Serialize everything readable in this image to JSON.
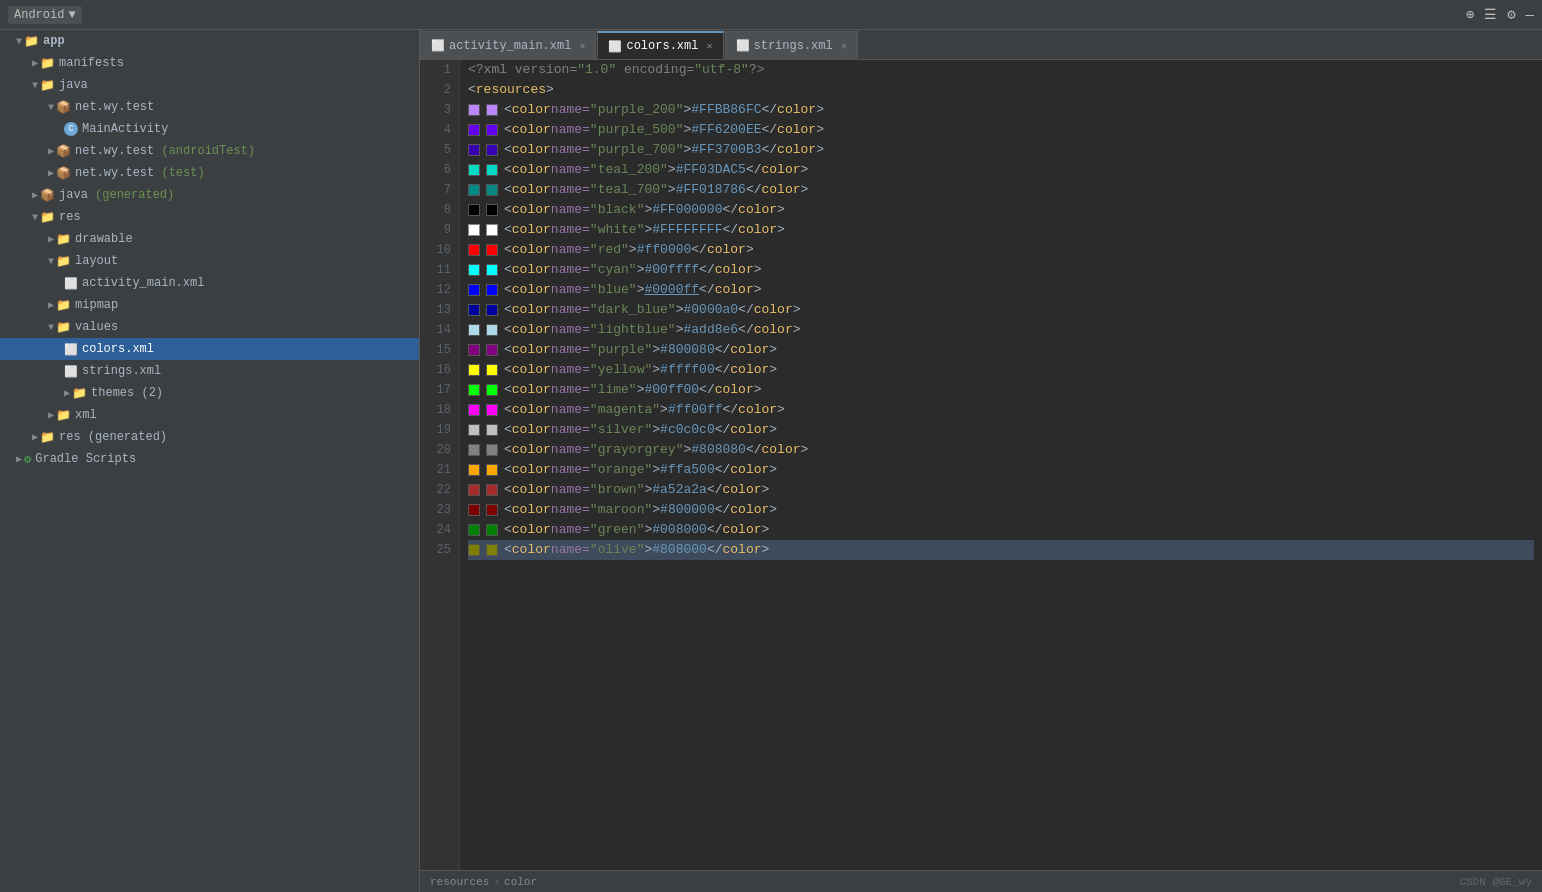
{
  "titlebar": {
    "project": "Android",
    "icons": [
      "sync",
      "lines",
      "settings",
      "minimize"
    ]
  },
  "tabs": [
    {
      "id": "activity_main",
      "label": "activity_main.xml",
      "active": false
    },
    {
      "id": "colors",
      "label": "colors.xml",
      "active": true
    },
    {
      "id": "strings",
      "label": "strings.xml",
      "active": false
    }
  ],
  "sidebar": {
    "items": [
      {
        "id": "app",
        "label": "app",
        "level": 0,
        "type": "folder-root",
        "expanded": true
      },
      {
        "id": "manifests",
        "label": "manifests",
        "level": 1,
        "type": "folder",
        "expanded": false
      },
      {
        "id": "java",
        "label": "java",
        "level": 1,
        "type": "folder",
        "expanded": true
      },
      {
        "id": "net.wy.test",
        "label": "net.wy.test",
        "level": 2,
        "type": "package",
        "expanded": true
      },
      {
        "id": "MainActivity",
        "label": "MainActivity",
        "level": 3,
        "type": "java-file"
      },
      {
        "id": "net.wy.test.android",
        "label": "net.wy.test (androidTest)",
        "level": 2,
        "type": "package",
        "expanded": false
      },
      {
        "id": "net.wy.test.test",
        "label": "net.wy.test (test)",
        "level": 2,
        "type": "package",
        "expanded": false
      },
      {
        "id": "java.generated",
        "label": "java (generated)",
        "level": 1,
        "type": "folder",
        "expanded": false
      },
      {
        "id": "res",
        "label": "res",
        "level": 1,
        "type": "folder",
        "expanded": true
      },
      {
        "id": "drawable",
        "label": "drawable",
        "level": 2,
        "type": "folder",
        "expanded": false
      },
      {
        "id": "layout",
        "label": "layout",
        "level": 2,
        "type": "folder",
        "expanded": true
      },
      {
        "id": "activity_main.xml",
        "label": "activity_main.xml",
        "level": 3,
        "type": "xml-file"
      },
      {
        "id": "mipmap",
        "label": "mipmap",
        "level": 2,
        "type": "folder",
        "expanded": false
      },
      {
        "id": "values",
        "label": "values",
        "level": 2,
        "type": "folder",
        "expanded": true
      },
      {
        "id": "colors.xml",
        "label": "colors.xml",
        "level": 3,
        "type": "xml-file",
        "selected": true
      },
      {
        "id": "strings.xml",
        "label": "strings.xml",
        "level": 3,
        "type": "xml-file"
      },
      {
        "id": "themes",
        "label": "themes (2)",
        "level": 3,
        "type": "folder",
        "expanded": false
      },
      {
        "id": "xml",
        "label": "xml",
        "level": 2,
        "type": "folder",
        "expanded": false
      },
      {
        "id": "res.generated",
        "label": "res (generated)",
        "level": 1,
        "type": "folder",
        "expanded": false
      },
      {
        "id": "gradle",
        "label": "Gradle Scripts",
        "level": 0,
        "type": "gradle",
        "expanded": false
      }
    ]
  },
  "code": {
    "lines": [
      {
        "num": 1,
        "swatch": null,
        "content": "<?xml version=\"1.0\" encoding=\"utf-8\"?>"
      },
      {
        "num": 2,
        "swatch": null,
        "content": "<resources>"
      },
      {
        "num": 3,
        "swatch": "#FFBB86FC",
        "swatchColor": "#FFBB86FC",
        "colorName": "purple_200",
        "colorHex": "#FFBB86FC"
      },
      {
        "num": 4,
        "swatch": "#FF6200EE",
        "swatchColor": "#FF6200EE",
        "colorName": "purple_500",
        "colorHex": "#FF6200EE"
      },
      {
        "num": 5,
        "swatch": "#FF3700B3",
        "swatchColor": "#FF3700B3",
        "colorName": "purple_700",
        "colorHex": "#FF3700B3"
      },
      {
        "num": 6,
        "swatch": "#FF03DAC5",
        "swatchColor": "#FF03DAC5",
        "colorName": "teal_200",
        "colorHex": "#FF03DAC5"
      },
      {
        "num": 7,
        "swatch": "#FF018786",
        "swatchColor": "#FF018786",
        "colorName": "teal_700",
        "colorHex": "#FF018786"
      },
      {
        "num": 8,
        "swatch": "#FF000000",
        "swatchColor": "#FF000000",
        "colorName": "black",
        "colorHex": "#FF000000"
      },
      {
        "num": 9,
        "swatch": "#FFFFFFFF",
        "swatchColor": "#FFFFFFFF",
        "colorName": "white",
        "colorHex": "#FFFFFFFF"
      },
      {
        "num": 10,
        "swatch": "#ff0000",
        "swatchColor": "#ff0000",
        "colorName": "red",
        "colorHex": "#ff0000"
      },
      {
        "num": 11,
        "swatch": "#00ffff",
        "swatchColor": "#00ffff",
        "colorName": "cyan",
        "colorHex": "#00ffff"
      },
      {
        "num": 12,
        "swatch": "#0000ff",
        "swatchColor": "#0000ff",
        "colorName": "blue",
        "colorHex": "#0000ff",
        "hexUnderline": true
      },
      {
        "num": 13,
        "swatch": "#0000a0",
        "swatchColor": "#0000a0",
        "colorName": "dark_blue",
        "colorHex": "#0000a0"
      },
      {
        "num": 14,
        "swatch": "#add8e6",
        "swatchColor": "#add8e6",
        "colorName": "lightblue",
        "colorHex": "#add8e6"
      },
      {
        "num": 15,
        "swatch": "#800080",
        "swatchColor": "#800080",
        "colorName": "purple",
        "colorHex": "#800080"
      },
      {
        "num": 16,
        "swatch": "#ffff00",
        "swatchColor": "#ffff00",
        "colorName": "yellow",
        "colorHex": "#ffff00"
      },
      {
        "num": 17,
        "swatch": "#00ff00",
        "swatchColor": "#00ff00",
        "colorName": "lime",
        "colorHex": "#00ff00"
      },
      {
        "num": 18,
        "swatch": "#ff00ff",
        "swatchColor": "#ff00ff",
        "colorName": "magenta",
        "colorHex": "#ff00ff"
      },
      {
        "num": 19,
        "swatch": "#c0c0c0",
        "swatchColor": "#c0c0c0",
        "colorName": "silver",
        "colorHex": "#c0c0c0"
      },
      {
        "num": 20,
        "swatch": "#808080",
        "swatchColor": "#808080",
        "colorName": "grayorgrey",
        "colorHex": "#808080"
      },
      {
        "num": 21,
        "swatch": "#ffa500",
        "swatchColor": "#ffa500",
        "colorName": "orange",
        "colorHex": "#ffa500"
      },
      {
        "num": 22,
        "swatch": "#a52a2a",
        "swatchColor": "#a52a2a",
        "colorName": "brown",
        "colorHex": "#a52a2a"
      },
      {
        "num": 23,
        "swatch": "#800000",
        "swatchColor": "#800000",
        "colorName": "maroon",
        "colorHex": "#800000"
      },
      {
        "num": 24,
        "swatch": "#008000",
        "swatchColor": "#008000",
        "colorName": "green",
        "colorHex": "#008000"
      },
      {
        "num": 25,
        "swatch": "#808000",
        "swatchColor": "#808000",
        "colorName": "olive",
        "colorHex": "#808000",
        "highlighted": true
      }
    ]
  },
  "statusbar": {
    "breadcrumb": [
      "resources",
      "color"
    ]
  },
  "watermark": "CSDN @GE_wy"
}
